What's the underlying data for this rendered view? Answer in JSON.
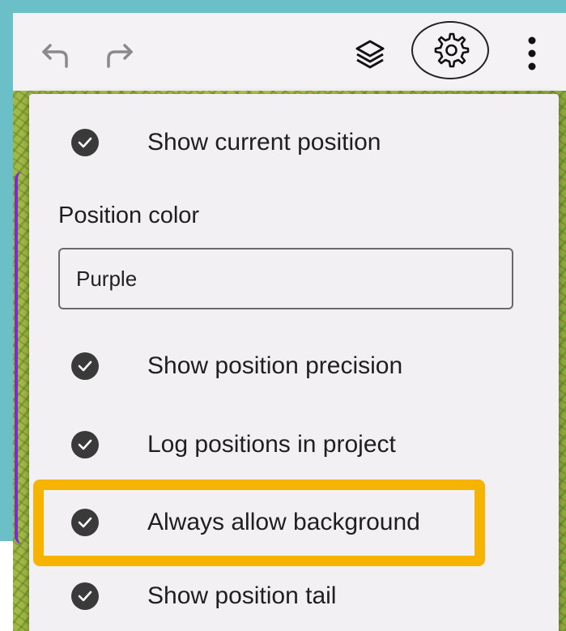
{
  "toolbar": {
    "undo_icon": "undo-arrow-icon",
    "redo_icon": "redo-arrow-icon",
    "layers_icon": "layers-icon",
    "settings_icon": "gear-icon",
    "more_icon": "vertical-ellipsis-icon"
  },
  "menu": {
    "show_current_position": "Show current position",
    "position_color_label": "Position color",
    "position_color_value": "Purple",
    "show_position_precision": "Show position precision",
    "log_positions": "Log positions in project",
    "always_allow_background": "Always allow background",
    "show_position_tail": "Show position tail"
  },
  "colors": {
    "teal_background": "#6bbfc6",
    "highlight": "#f6b300",
    "menu_background": "#f2f0f3",
    "check_fill": "#3a3a3a"
  }
}
